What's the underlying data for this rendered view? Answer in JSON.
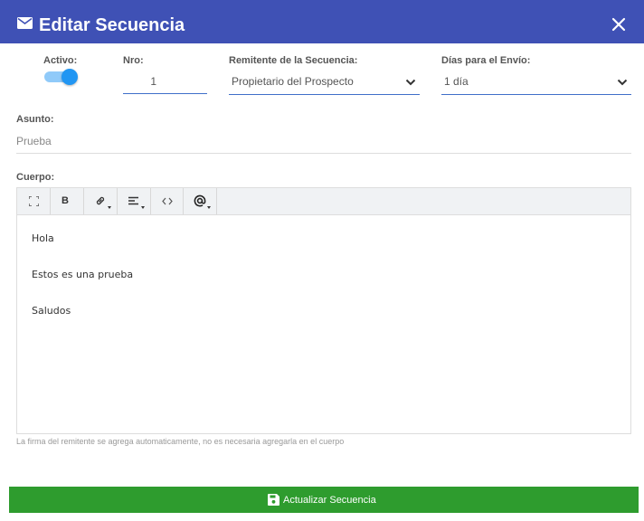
{
  "header": {
    "title": "Editar Secuencia"
  },
  "form": {
    "activo_label": "Activo:",
    "activo_on": true,
    "nro_label": "Nro:",
    "nro_value": "1",
    "remitente_label": "Remitente de la Secuencia:",
    "remitente_value": "Propietario del Prospecto",
    "dias_label": "Días para el Envío:",
    "dias_value": "1 día",
    "asunto_label": "Asunto:",
    "asunto_value": "Prueba",
    "cuerpo_label": "Cuerpo:"
  },
  "editor": {
    "toolbar": [
      "fullscreen-icon",
      "bold",
      "link-icon",
      "align-icon",
      "code-icon",
      "mention-icon"
    ],
    "bold_label": "B",
    "lines": [
      "Hola",
      "Estos es una prueba",
      "Saludos"
    ]
  },
  "hint": "La firma del remitente se agrega automaticamente, no es necesaria agregarla en el cuerpo",
  "submit": {
    "label": "Actualizar Secuencia"
  },
  "colors": {
    "header": "#3f51b5",
    "accent": "#2196f3",
    "submit": "#2e9c2e"
  }
}
